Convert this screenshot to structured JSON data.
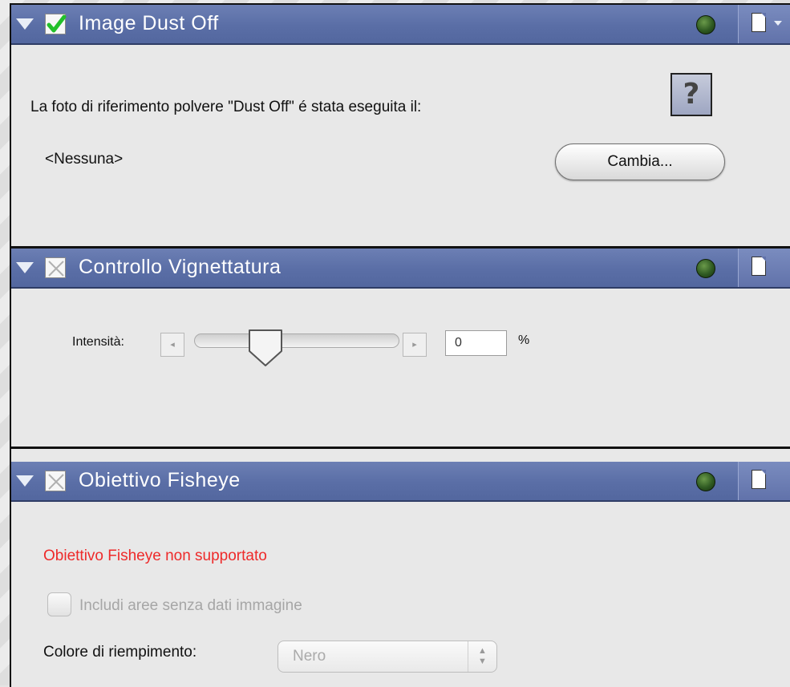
{
  "sections": [
    {
      "title": "Image Dust Off",
      "enabled": true,
      "description": "La foto di riferimento polvere \"Dust Off\" é stata eseguita il:",
      "reference_value": "<Nessuna>",
      "help_label": "?",
      "change_button_label": "Cambia..."
    },
    {
      "title": "Controllo Vignettatura",
      "enabled": false,
      "intensity_label": "Intensità:",
      "intensity_value": "0",
      "intensity_unit": "%",
      "slider_left_arrow": "◂",
      "slider_right_arrow": "▸"
    },
    {
      "title": "Obiettivo Fisheye",
      "enabled": false,
      "warning": "Obiettivo Fisheye non supportato",
      "include_label": "Includi aree senza dati immagine",
      "fill_color_label": "Colore di riempimento:",
      "fill_color_value": "Nero",
      "select_arrows": "▲▼"
    }
  ],
  "colors": {
    "header": "#5a6ea6",
    "status_led": "#2f5a22",
    "warning_text": "#ee2a2a",
    "check_green": "#22c02a"
  },
  "icons": [
    "disclosure-triangle-icon",
    "checkbox-icon",
    "status-led-icon",
    "document-icon",
    "help-icon"
  ]
}
